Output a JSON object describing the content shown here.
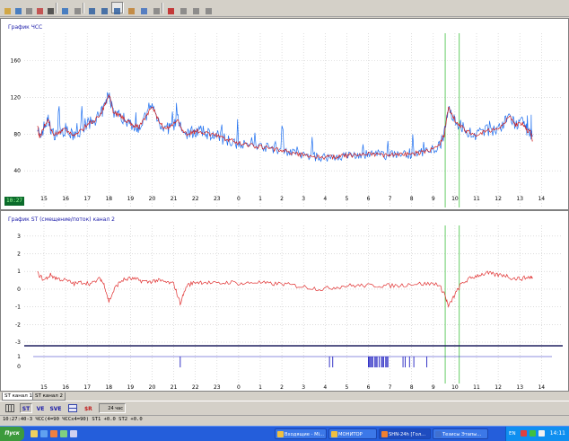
{
  "toolbar": {
    "button_count": 17
  },
  "hr_panel": {
    "title": "График ЧСС",
    "clock": "10:27",
    "y_ticks": [
      "160",
      "120",
      "80",
      "40"
    ],
    "x_ticks": [
      "15",
      "16",
      "17",
      "18",
      "19",
      "20",
      "21",
      "22",
      "23",
      "0",
      "1",
      "2",
      "3",
      "4",
      "5",
      "6",
      "7",
      "8",
      "9",
      "10",
      "11",
      "12",
      "13",
      "14"
    ]
  },
  "st_panel": {
    "title": "График ST (смещение/поток) канал 2",
    "y_ticks": [
      "3",
      "2",
      "1",
      "0",
      "-1",
      "-2",
      "-3"
    ],
    "event_ticks": [
      "1",
      "0"
    ],
    "x_ticks": [
      "15",
      "16",
      "17",
      "18",
      "19",
      "20",
      "21",
      "22",
      "23",
      "0",
      "1",
      "2",
      "3",
      "4",
      "5",
      "6",
      "7",
      "8",
      "9",
      "10",
      "11",
      "12",
      "13",
      "14"
    ]
  },
  "tabs": [
    "ST канал 1",
    "ST канал 2"
  ],
  "bottom": {
    "st_label": "ST",
    "ve_label": "VE",
    "sve_label": "SVE",
    "zoom_label": "24 час"
  },
  "status": {
    "text": "10:27:40-3 ЧСС(4=90 ЧССх4=90) ST1 +0.0 ST2 +0.0"
  },
  "taskbar": {
    "start": "Пуск",
    "tasks": [
      "Входящие - Mi...",
      "МОНИТОР",
      "SHN-24h [Гол...",
      "Тезисы Этапы..."
    ],
    "tray_lang": "EN",
    "time": "14:11"
  },
  "colors": {
    "hr_trace": "#1e6ff0",
    "hr_mean": "#d01c1c",
    "st_trace": "#e03030",
    "event": "#2020c0",
    "marker": "#40c040"
  },
  "chart_data": [
    {
      "type": "line",
      "title": "График ЧСС",
      "x_categories": [
        "15",
        "16",
        "17",
        "18",
        "19",
        "20",
        "21",
        "22",
        "23",
        "0",
        "1",
        "2",
        "3",
        "4",
        "5",
        "6",
        "7",
        "8",
        "9",
        "10",
        "11",
        "12",
        "13",
        "14"
      ],
      "ylim": [
        0,
        190
      ],
      "grid": true,
      "series": [
        {
          "points": [
            [
              14.7,
              90
            ],
            [
              14.8,
              75
            ],
            [
              15.0,
              88
            ],
            [
              15.2,
              95
            ],
            [
              15.4,
              80
            ],
            [
              15.7,
              82
            ],
            [
              16.0,
              85
            ],
            [
              16.3,
              78
            ],
            [
              16.6,
              82
            ],
            [
              17.0,
              90
            ],
            [
              17.3,
              95
            ],
            [
              17.6,
              100
            ],
            [
              17.8,
              110
            ],
            [
              18.0,
              125
            ],
            [
              18.2,
              105
            ],
            [
              18.5,
              100
            ],
            [
              18.8,
              95
            ],
            [
              19.1,
              90
            ],
            [
              19.4,
              88
            ],
            [
              19.7,
              98
            ],
            [
              20.0,
              110
            ],
            [
              20.3,
              95
            ],
            [
              20.6,
              85
            ],
            [
              20.9,
              88
            ],
            [
              21.2,
              95
            ],
            [
              21.5,
              80
            ],
            [
              21.8,
              82
            ],
            [
              22.1,
              83
            ],
            [
              22.4,
              82
            ],
            [
              22.7,
              80
            ],
            [
              23.0,
              78
            ],
            [
              23.3,
              75
            ],
            [
              23.6,
              74
            ],
            [
              24.0,
              70
            ],
            [
              24.4,
              68
            ],
            [
              24.8,
              67
            ],
            [
              25.2,
              66
            ],
            [
              25.6,
              64
            ],
            [
              26.0,
              62
            ],
            [
              26.4,
              60
            ],
            [
              26.8,
              58
            ],
            [
              27.2,
              56
            ],
            [
              27.6,
              55
            ],
            [
              28.0,
              55
            ],
            [
              28.4,
              55
            ],
            [
              28.8,
              56
            ],
            [
              29.2,
              57
            ],
            [
              29.6,
              57
            ],
            [
              30.0,
              58
            ],
            [
              30.4,
              58
            ],
            [
              30.8,
              57
            ],
            [
              31.2,
              58
            ],
            [
              31.6,
              58
            ],
            [
              32.0,
              58
            ],
            [
              32.4,
              60
            ],
            [
              32.8,
              62
            ],
            [
              33.2,
              65
            ],
            [
              33.5,
              78
            ],
            [
              33.7,
              110
            ],
            [
              34.0,
              95
            ],
            [
              34.3,
              88
            ],
            [
              34.6,
              82
            ],
            [
              35.0,
              80
            ],
            [
              35.4,
              83
            ],
            [
              35.8,
              85
            ],
            [
              36.2,
              88
            ],
            [
              36.5,
              100
            ],
            [
              36.8,
              90
            ],
            [
              37.1,
              92
            ],
            [
              37.3,
              85
            ],
            [
              37.5,
              82
            ],
            [
              37.6,
              72
            ]
          ]
        }
      ]
    },
    {
      "type": "line",
      "title": "График ST (смещение/поток) канал 2",
      "x_categories": [
        "15",
        "16",
        "17",
        "18",
        "19",
        "20",
        "21",
        "22",
        "23",
        "0",
        "1",
        "2",
        "3",
        "4",
        "5",
        "6",
        "7",
        "8",
        "9",
        "10",
        "11",
        "12",
        "13",
        "14"
      ],
      "ylim": [
        -3,
        3.6
      ],
      "grid": true,
      "series": [
        {
          "points": [
            [
              14.7,
              0.9
            ],
            [
              15.0,
              0.5
            ],
            [
              15.3,
              0.8
            ],
            [
              15.6,
              0.6
            ],
            [
              16.0,
              0.5
            ],
            [
              16.4,
              0.3
            ],
            [
              16.8,
              0.4
            ],
            [
              17.2,
              0.3
            ],
            [
              17.6,
              0.6
            ],
            [
              17.8,
              0.2
            ],
            [
              18.0,
              -0.7
            ],
            [
              18.3,
              0.1
            ],
            [
              18.6,
              0.5
            ],
            [
              19.0,
              0.6
            ],
            [
              19.4,
              0.5
            ],
            [
              19.8,
              0.4
            ],
            [
              20.2,
              0.5
            ],
            [
              20.6,
              0.4
            ],
            [
              21.0,
              0.3
            ],
            [
              21.3,
              -0.8
            ],
            [
              21.6,
              0.2
            ],
            [
              22.0,
              0.4
            ],
            [
              22.4,
              0.4
            ],
            [
              23.0,
              0.3
            ],
            [
              23.6,
              0.4
            ],
            [
              24.2,
              0.3
            ],
            [
              24.8,
              0.4
            ],
            [
              25.4,
              0.3
            ],
            [
              26.0,
              0.3
            ],
            [
              26.6,
              0.2
            ],
            [
              27.2,
              0.1
            ],
            [
              27.8,
              0.0
            ],
            [
              28.4,
              0.1
            ],
            [
              29.0,
              0.2
            ],
            [
              29.6,
              0.2
            ],
            [
              30.2,
              0.2
            ],
            [
              30.8,
              0.2
            ],
            [
              31.4,
              0.2
            ],
            [
              32.0,
              0.3
            ],
            [
              32.6,
              0.3
            ],
            [
              33.2,
              0.3
            ],
            [
              33.5,
              -0.2
            ],
            [
              33.7,
              -1.0
            ],
            [
              34.0,
              -0.3
            ],
            [
              34.3,
              0.3
            ],
            [
              34.7,
              0.6
            ],
            [
              35.1,
              0.8
            ],
            [
              35.5,
              0.9
            ],
            [
              35.9,
              0.8
            ],
            [
              36.3,
              0.8
            ],
            [
              36.7,
              0.6
            ],
            [
              37.1,
              0.6
            ],
            [
              37.5,
              0.7
            ],
            [
              37.6,
              0.6
            ]
          ]
        }
      ]
    }
  ]
}
